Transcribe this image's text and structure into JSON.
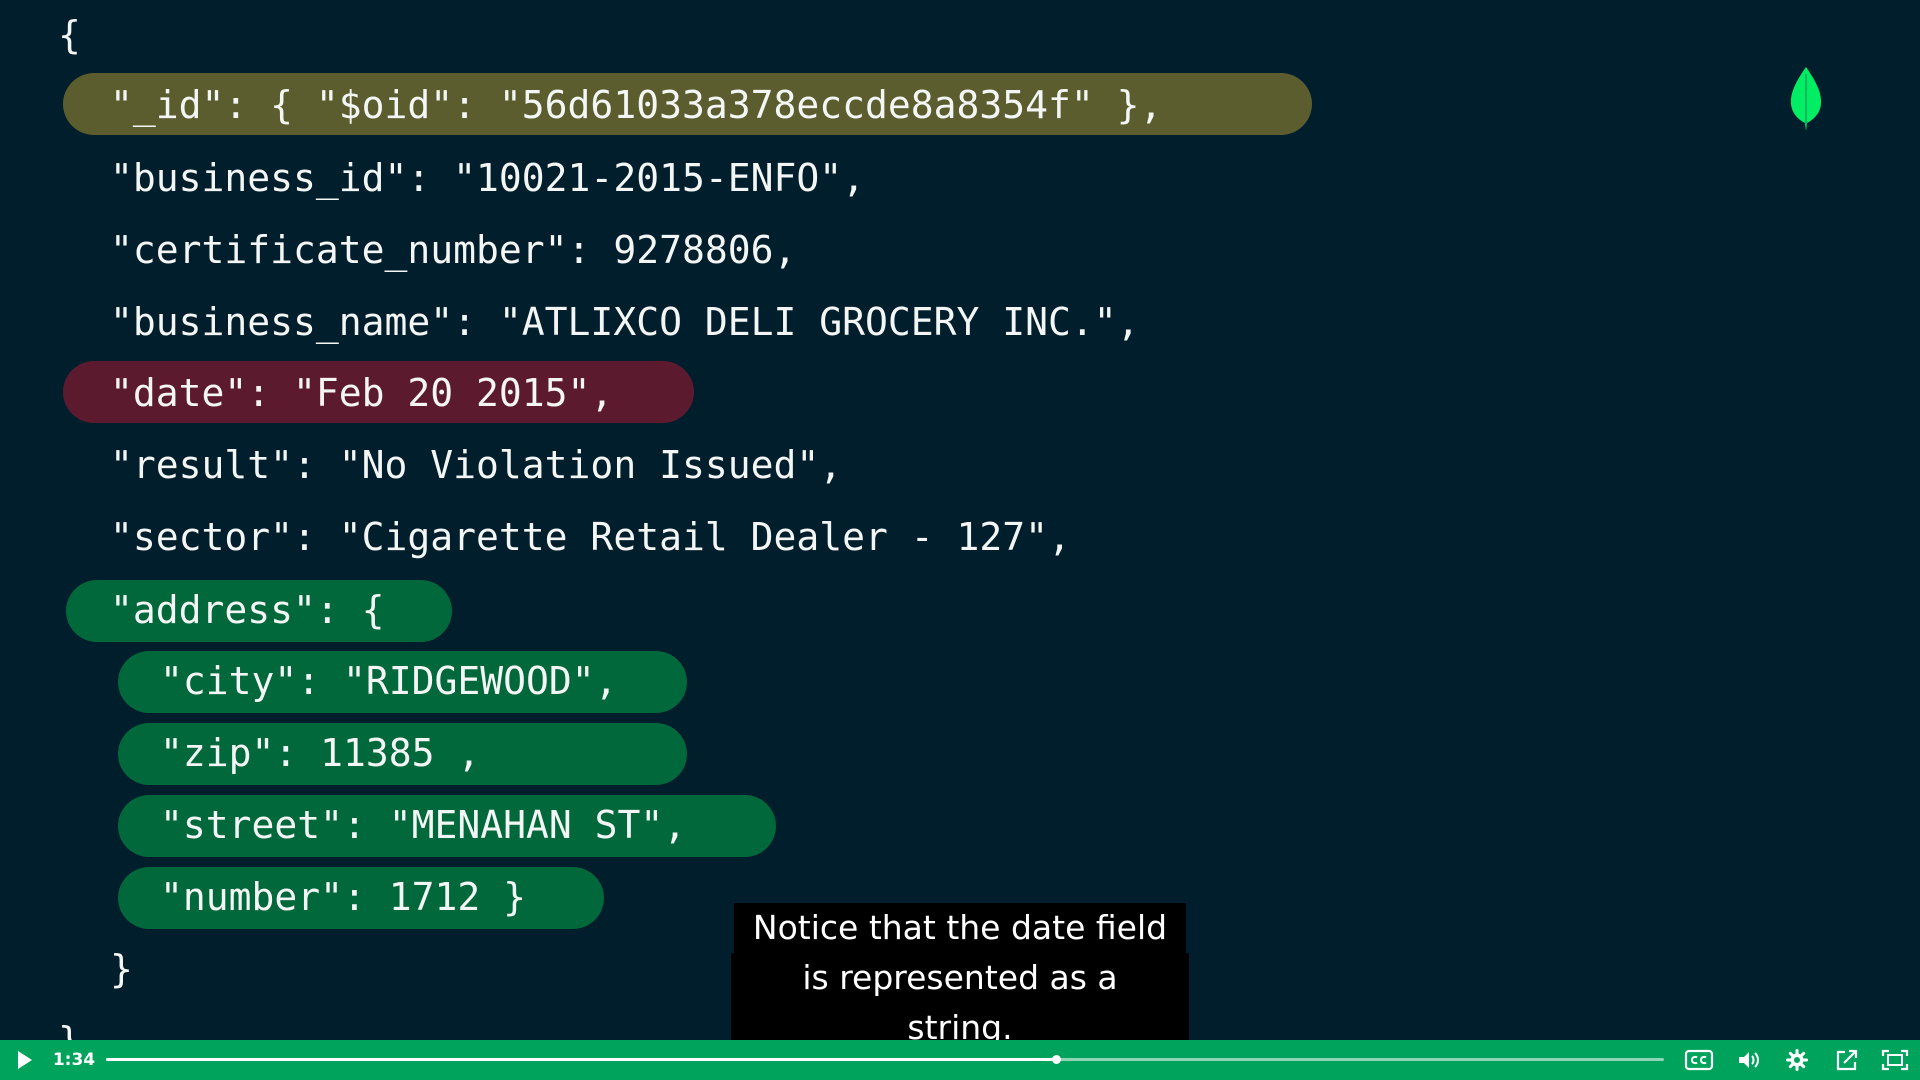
{
  "code": {
    "lines": [
      "{",
      "\"_id\": { \"$oid\": \"56d61033a378eccde8a8354f\" },",
      "\"business_id\": \"10021-2015-ENFO\",",
      "\"certificate_number\": 9278806,",
      "\"business_name\": \"ATLIXCO DELI GROCERY INC.\",",
      "\"date\": \"Feb 20 2015\",",
      "\"result\": \"No Violation Issued\",",
      "\"sector\": \"Cigarette Retail Dealer - 127\",",
      "\"address\": {",
      "\"city\": \"RIDGEWOOD\",",
      "\"zip\": 11385 ,",
      "\"street\": \"MENAHAN ST\",",
      "\"number\": 1712 }",
      "}",
      "}"
    ]
  },
  "highlight_colors": {
    "id_field": "#5b5d2e",
    "date_field": "#5c1a2e",
    "address_fields": "#00683a"
  },
  "logo": {
    "icon": "mongodb-leaf-icon",
    "color": "#00ed64"
  },
  "caption": {
    "line1": "Notice that the date field",
    "line2": "is represented as a string."
  },
  "player": {
    "current_time": "1:34",
    "progress_fraction": 0.61,
    "bar_color": "#00a35c",
    "icons": [
      "play-icon",
      "closed-captions-icon",
      "volume-icon",
      "settings-gear-icon",
      "share-icon",
      "fullscreen-icon"
    ]
  }
}
